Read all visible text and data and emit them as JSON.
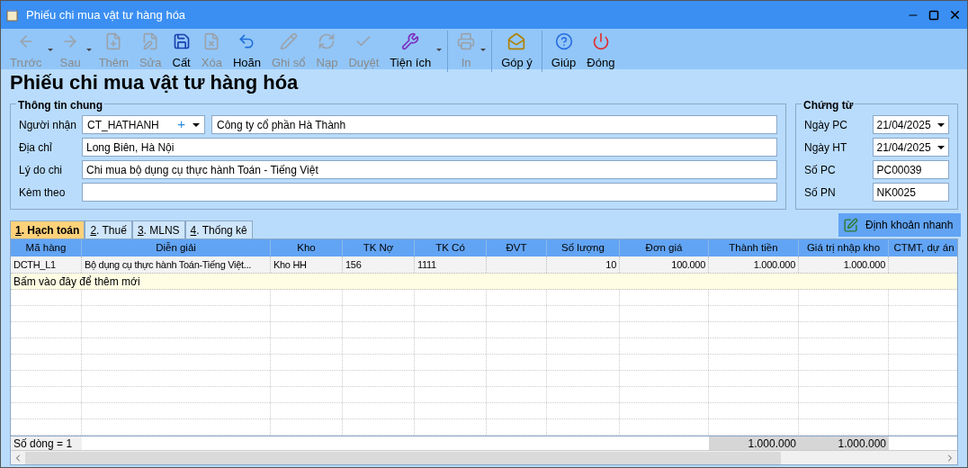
{
  "window": {
    "title": "Phiếu chi mua vật tư hàng hóa"
  },
  "toolbar": {
    "groups": [
      {
        "buttons": [
          {
            "label": "Trước",
            "kind": "back",
            "disabled": true,
            "dropdown": true
          },
          {
            "label": "Sau",
            "kind": "forward",
            "disabled": true,
            "dropdown": true
          },
          {
            "label": "Thêm",
            "kind": "add",
            "disabled": true,
            "dropdown": false
          },
          {
            "label": "Sửa",
            "kind": "edit",
            "disabled": true,
            "dropdown": false
          },
          {
            "label": "Cất",
            "kind": "save",
            "disabled": false,
            "dropdown": false
          },
          {
            "label": "Xóa",
            "kind": "delete",
            "disabled": true,
            "dropdown": false
          },
          {
            "label": "Hoãn",
            "kind": "undo",
            "disabled": false,
            "dropdown": false
          },
          {
            "label": "Ghi sổ",
            "kind": "post",
            "disabled": true,
            "dropdown": false
          },
          {
            "label": "Nạp",
            "kind": "reload",
            "disabled": true,
            "dropdown": false
          },
          {
            "label": "Duyệt",
            "kind": "approve",
            "disabled": true,
            "dropdown": false
          },
          {
            "label": "Tiện ích",
            "kind": "tools",
            "disabled": false,
            "dropdown": true
          }
        ]
      },
      {
        "buttons": [
          {
            "label": "In",
            "kind": "print",
            "disabled": true,
            "dropdown": true
          }
        ]
      },
      {
        "buttons": [
          {
            "label": "Góp ý",
            "kind": "feedback",
            "disabled": false,
            "dropdown": false
          }
        ]
      },
      {
        "buttons": [
          {
            "label": "Giúp",
            "kind": "help",
            "disabled": false,
            "dropdown": false
          },
          {
            "label": "Đóng",
            "kind": "close",
            "disabled": false,
            "dropdown": false
          }
        ]
      }
    ]
  },
  "heading": "Phiếu chi mua vật tư hàng hóa",
  "general": {
    "title": "Thông tin chung",
    "recipient": {
      "label": "Người nhận",
      "code": "CT_HATHANH",
      "plus": "+",
      "name": "Công ty cổ phần Hà Thành"
    },
    "fields": [
      {
        "label": "Địa chỉ",
        "value": "Long Biên, Hà Nội"
      },
      {
        "label": "Lý do chi",
        "value": "Chi mua bộ dụng cụ thực hành Toán - Tiếng Việt"
      },
      {
        "label": "Kèm theo"
      }
    ]
  },
  "voucher": {
    "title": "Chứng từ",
    "fields": [
      {
        "label": "Ngày PC",
        "value": "21/04/2025",
        "kind": "date"
      },
      {
        "label": "Ngày HT",
        "value": "21/04/2025",
        "kind": "date"
      },
      {
        "label": "Số PC",
        "value": "PC00039",
        "kind": "text"
      },
      {
        "label": "Số PN",
        "value": "NK0025",
        "kind": "text"
      }
    ]
  },
  "tabs": [
    {
      "label": "1. Hạch toán",
      "selected": true
    },
    {
      "label": "2. Thuế",
      "selected": false
    },
    {
      "label": "3. MLNS",
      "selected": false
    },
    {
      "label": "4. Thống kê",
      "selected": false
    }
  ],
  "quick_button": "Định khoản nhanh",
  "table": {
    "columns": [
      "Mã hàng",
      "Diễn giải",
      "Kho",
      "TK Nợ",
      "TK Có",
      "ĐVT",
      "Số lượng",
      "Đơn giá",
      "Thành tiền",
      "Giá trị nhập kho",
      "CTMT, dự án"
    ],
    "rows": [
      [
        "DCTH_L1",
        "Bộ dụng cụ thực hành Toán-Tiếng Việt...",
        "Kho HH",
        "156",
        "1111",
        null,
        "10",
        "100.000",
        "1.000.000",
        "1.000.000",
        null
      ]
    ],
    "new_row_hint": "Bấm vào đây để thêm mới",
    "footer": {
      "count": "Số dòng = 1",
      "amount_total": "1.000.000",
      "value_total": "1.000.000"
    }
  }
}
